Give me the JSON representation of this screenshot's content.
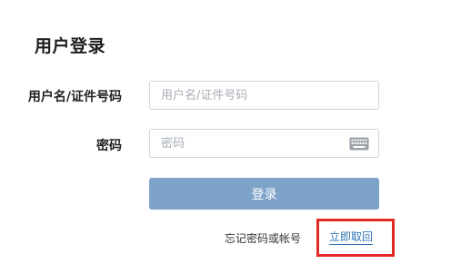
{
  "form": {
    "title": "用户登录",
    "username": {
      "label": "用户名/证件号码",
      "placeholder": "用户名/证件号码",
      "value": ""
    },
    "password": {
      "label": "密码",
      "placeholder": "密码",
      "value": "",
      "icon": "keyboard-icon"
    },
    "submit_label": "登录",
    "forgot_text": "忘记密码或帐号",
    "recover_link": "立即取回"
  },
  "colors": {
    "button_bg": "#7ea3c8",
    "link": "#2f73b4",
    "highlight_border": "#e12a26"
  }
}
